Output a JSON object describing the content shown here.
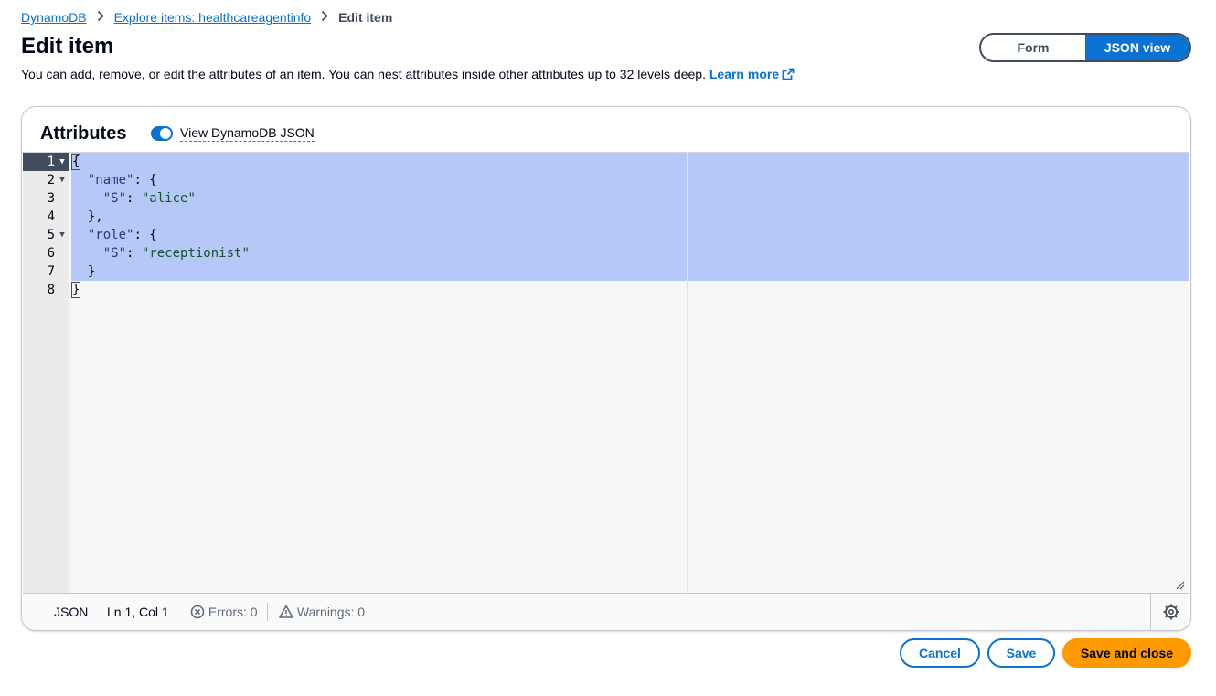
{
  "breadcrumb": {
    "items": [
      {
        "label": "DynamoDB"
      },
      {
        "label": "Explore items: healthcareagentinfo"
      }
    ],
    "current": "Edit item"
  },
  "page": {
    "title": "Edit item",
    "description": "You can add, remove, or edit the attributes of an item. You can nest attributes inside other attributes up to 32 levels deep.",
    "learn_more": "Learn more"
  },
  "view_toggle": {
    "options": [
      {
        "label": "Form",
        "selected": false
      },
      {
        "label": "JSON view",
        "selected": true
      }
    ]
  },
  "attributes": {
    "title": "Attributes",
    "toggle_label": "View DynamoDB JSON",
    "toggle_on": true
  },
  "editor": {
    "line_numbers": [
      "1",
      "2",
      "3",
      "4",
      "5",
      "6",
      "7",
      "8"
    ],
    "lines": [
      [
        {
          "t": "p",
          "v": "{"
        }
      ],
      [
        {
          "t": "p",
          "v": "  "
        },
        {
          "t": "k",
          "v": "\"name\""
        },
        {
          "t": "p",
          "v": ": {"
        }
      ],
      [
        {
          "t": "p",
          "v": "    "
        },
        {
          "t": "k",
          "v": "\"S\""
        },
        {
          "t": "p",
          "v": ": "
        },
        {
          "t": "s",
          "v": "\"alice\""
        }
      ],
      [
        {
          "t": "p",
          "v": "  },"
        }
      ],
      [
        {
          "t": "p",
          "v": "  "
        },
        {
          "t": "k",
          "v": "\"role\""
        },
        {
          "t": "p",
          "v": ": {"
        }
      ],
      [
        {
          "t": "p",
          "v": "    "
        },
        {
          "t": "k",
          "v": "\"S\""
        },
        {
          "t": "p",
          "v": ": "
        },
        {
          "t": "s",
          "v": "\"receptionist\""
        }
      ],
      [
        {
          "t": "p",
          "v": "  }"
        }
      ],
      [
        {
          "t": "p",
          "v": "}"
        }
      ]
    ],
    "fold_lines": [
      1,
      2,
      5
    ],
    "active_line": 1
  },
  "status_bar": {
    "language": "JSON",
    "cursor": "Ln 1, Col 1",
    "errors": "Errors: 0",
    "warnings": "Warnings: 0"
  },
  "actions": {
    "cancel": "Cancel",
    "save": "Save",
    "save_close": "Save and close"
  },
  "colors": {
    "link": "#0972d3",
    "primary_button": "#ff9900",
    "selection": "#b5c8f7",
    "text": "#000716"
  },
  "icons": [
    "chevron-right-icon",
    "external-link-icon",
    "fold-arrow-icon",
    "resize-handle-icon",
    "error-circle-icon",
    "warning-triangle-icon",
    "gear-icon"
  ]
}
